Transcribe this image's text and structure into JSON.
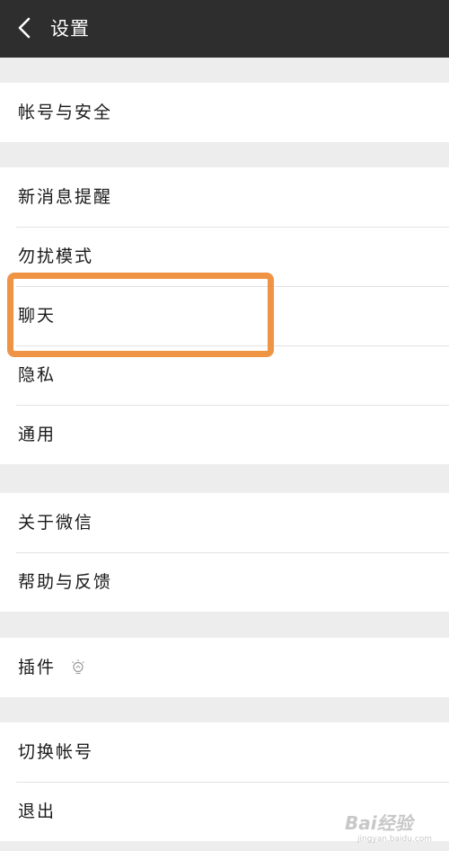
{
  "header": {
    "title": "设置",
    "back_icon": "chevron-left-icon"
  },
  "groups": [
    {
      "items": [
        {
          "label": "帐号与安全"
        }
      ]
    },
    {
      "items": [
        {
          "label": "新消息提醒"
        },
        {
          "label": "勿扰模式"
        },
        {
          "label": "聊天"
        },
        {
          "label": "隐私"
        },
        {
          "label": "通用"
        }
      ]
    },
    {
      "items": [
        {
          "label": "关于微信"
        },
        {
          "label": "帮助与反馈"
        }
      ]
    },
    {
      "items": [
        {
          "label": "插件",
          "icon": "lightbulb-icon"
        }
      ]
    },
    {
      "items": [
        {
          "label": "切换帐号"
        },
        {
          "label": "退出"
        }
      ]
    }
  ],
  "highlight": {
    "target": "聊天",
    "color": "#ef9445"
  },
  "watermark": {
    "logo": "Bai经验",
    "sub": "jingyan.baidu.com"
  },
  "colors": {
    "topbar": "#2e2e2e",
    "background": "#ededed",
    "row": "#ffffff"
  }
}
